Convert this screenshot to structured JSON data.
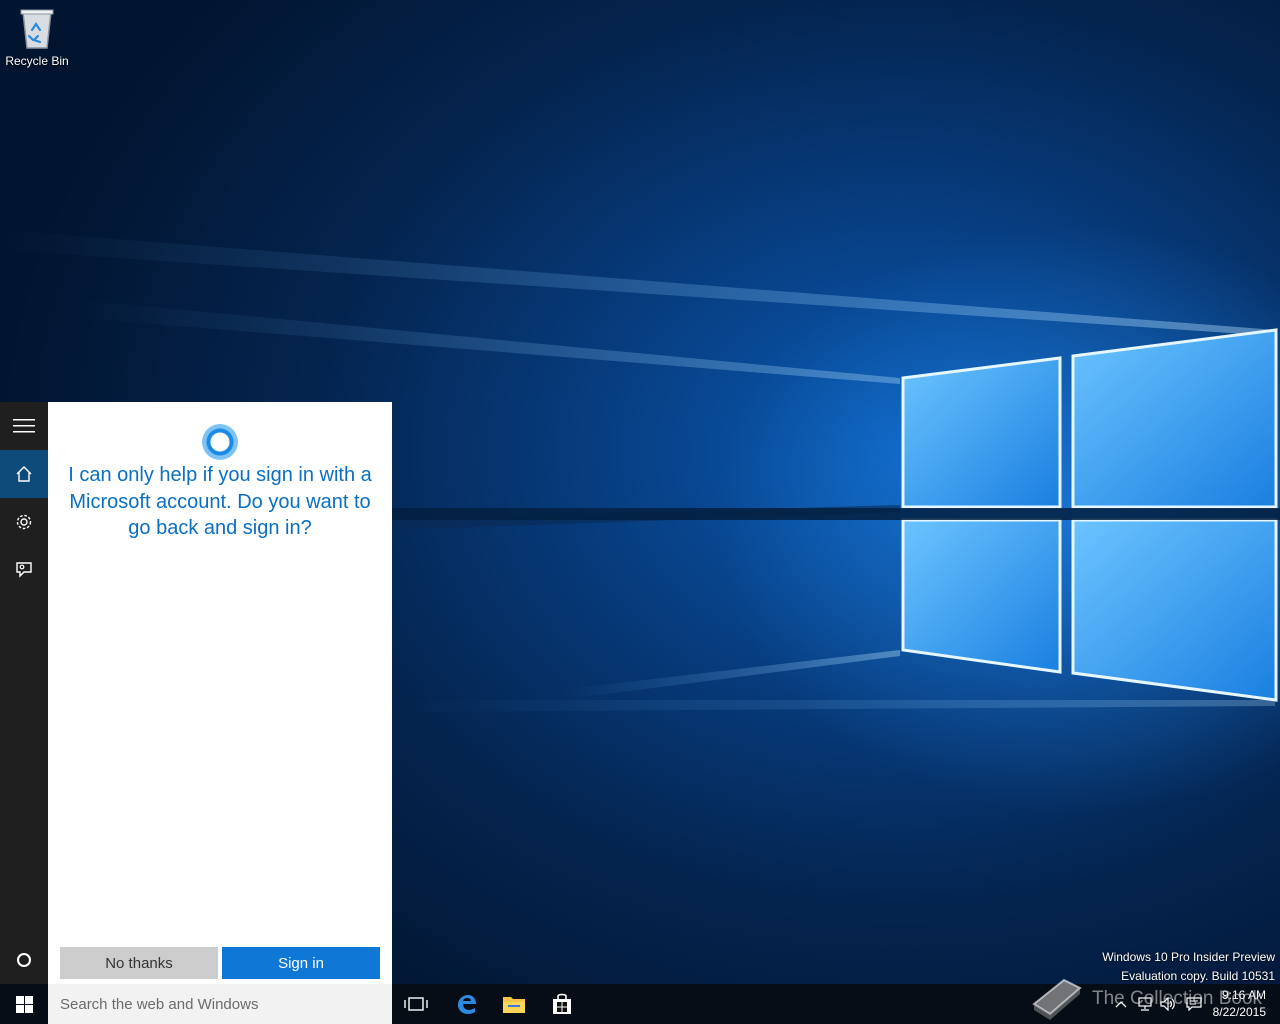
{
  "desktop": {
    "icons": [
      {
        "label": "Recycle Bin",
        "icon": "recycle-bin-icon"
      }
    ]
  },
  "cortana": {
    "rail": [
      {
        "name": "menu",
        "icon": "hamburger-icon"
      },
      {
        "name": "home",
        "icon": "home-icon",
        "active": true
      },
      {
        "name": "settings",
        "icon": "gear-icon"
      },
      {
        "name": "feedback",
        "icon": "feedback-icon"
      },
      {
        "name": "cortana",
        "icon": "cortana-circle-icon"
      }
    ],
    "message": "I can only help if you sign in with a Microsoft account. Do you want to go back and sign in?",
    "buttons": {
      "no_thanks": "No thanks",
      "sign_in": "Sign in"
    }
  },
  "taskbar": {
    "search_placeholder": "Search the web and Windows",
    "apps": [
      {
        "name": "task-view",
        "icon": "task-view-icon"
      },
      {
        "name": "edge",
        "icon": "edge-icon"
      },
      {
        "name": "file-explorer",
        "icon": "folder-icon"
      },
      {
        "name": "store",
        "icon": "store-icon"
      }
    ],
    "clock": {
      "time": "9:16 AM",
      "date": "8/22/2015"
    }
  },
  "watermark": {
    "line1": "Windows 10 Pro Insider Preview",
    "line2": "Evaluation copy. Build 10531",
    "brand": "The Collection Book"
  },
  "colors": {
    "accent": "#0f78d7",
    "cortana_text": "#0a6fc2",
    "rail_bg": "#1f1f1f",
    "rail_active": "#0e4a7a",
    "taskbar_bg": "#070d16"
  }
}
